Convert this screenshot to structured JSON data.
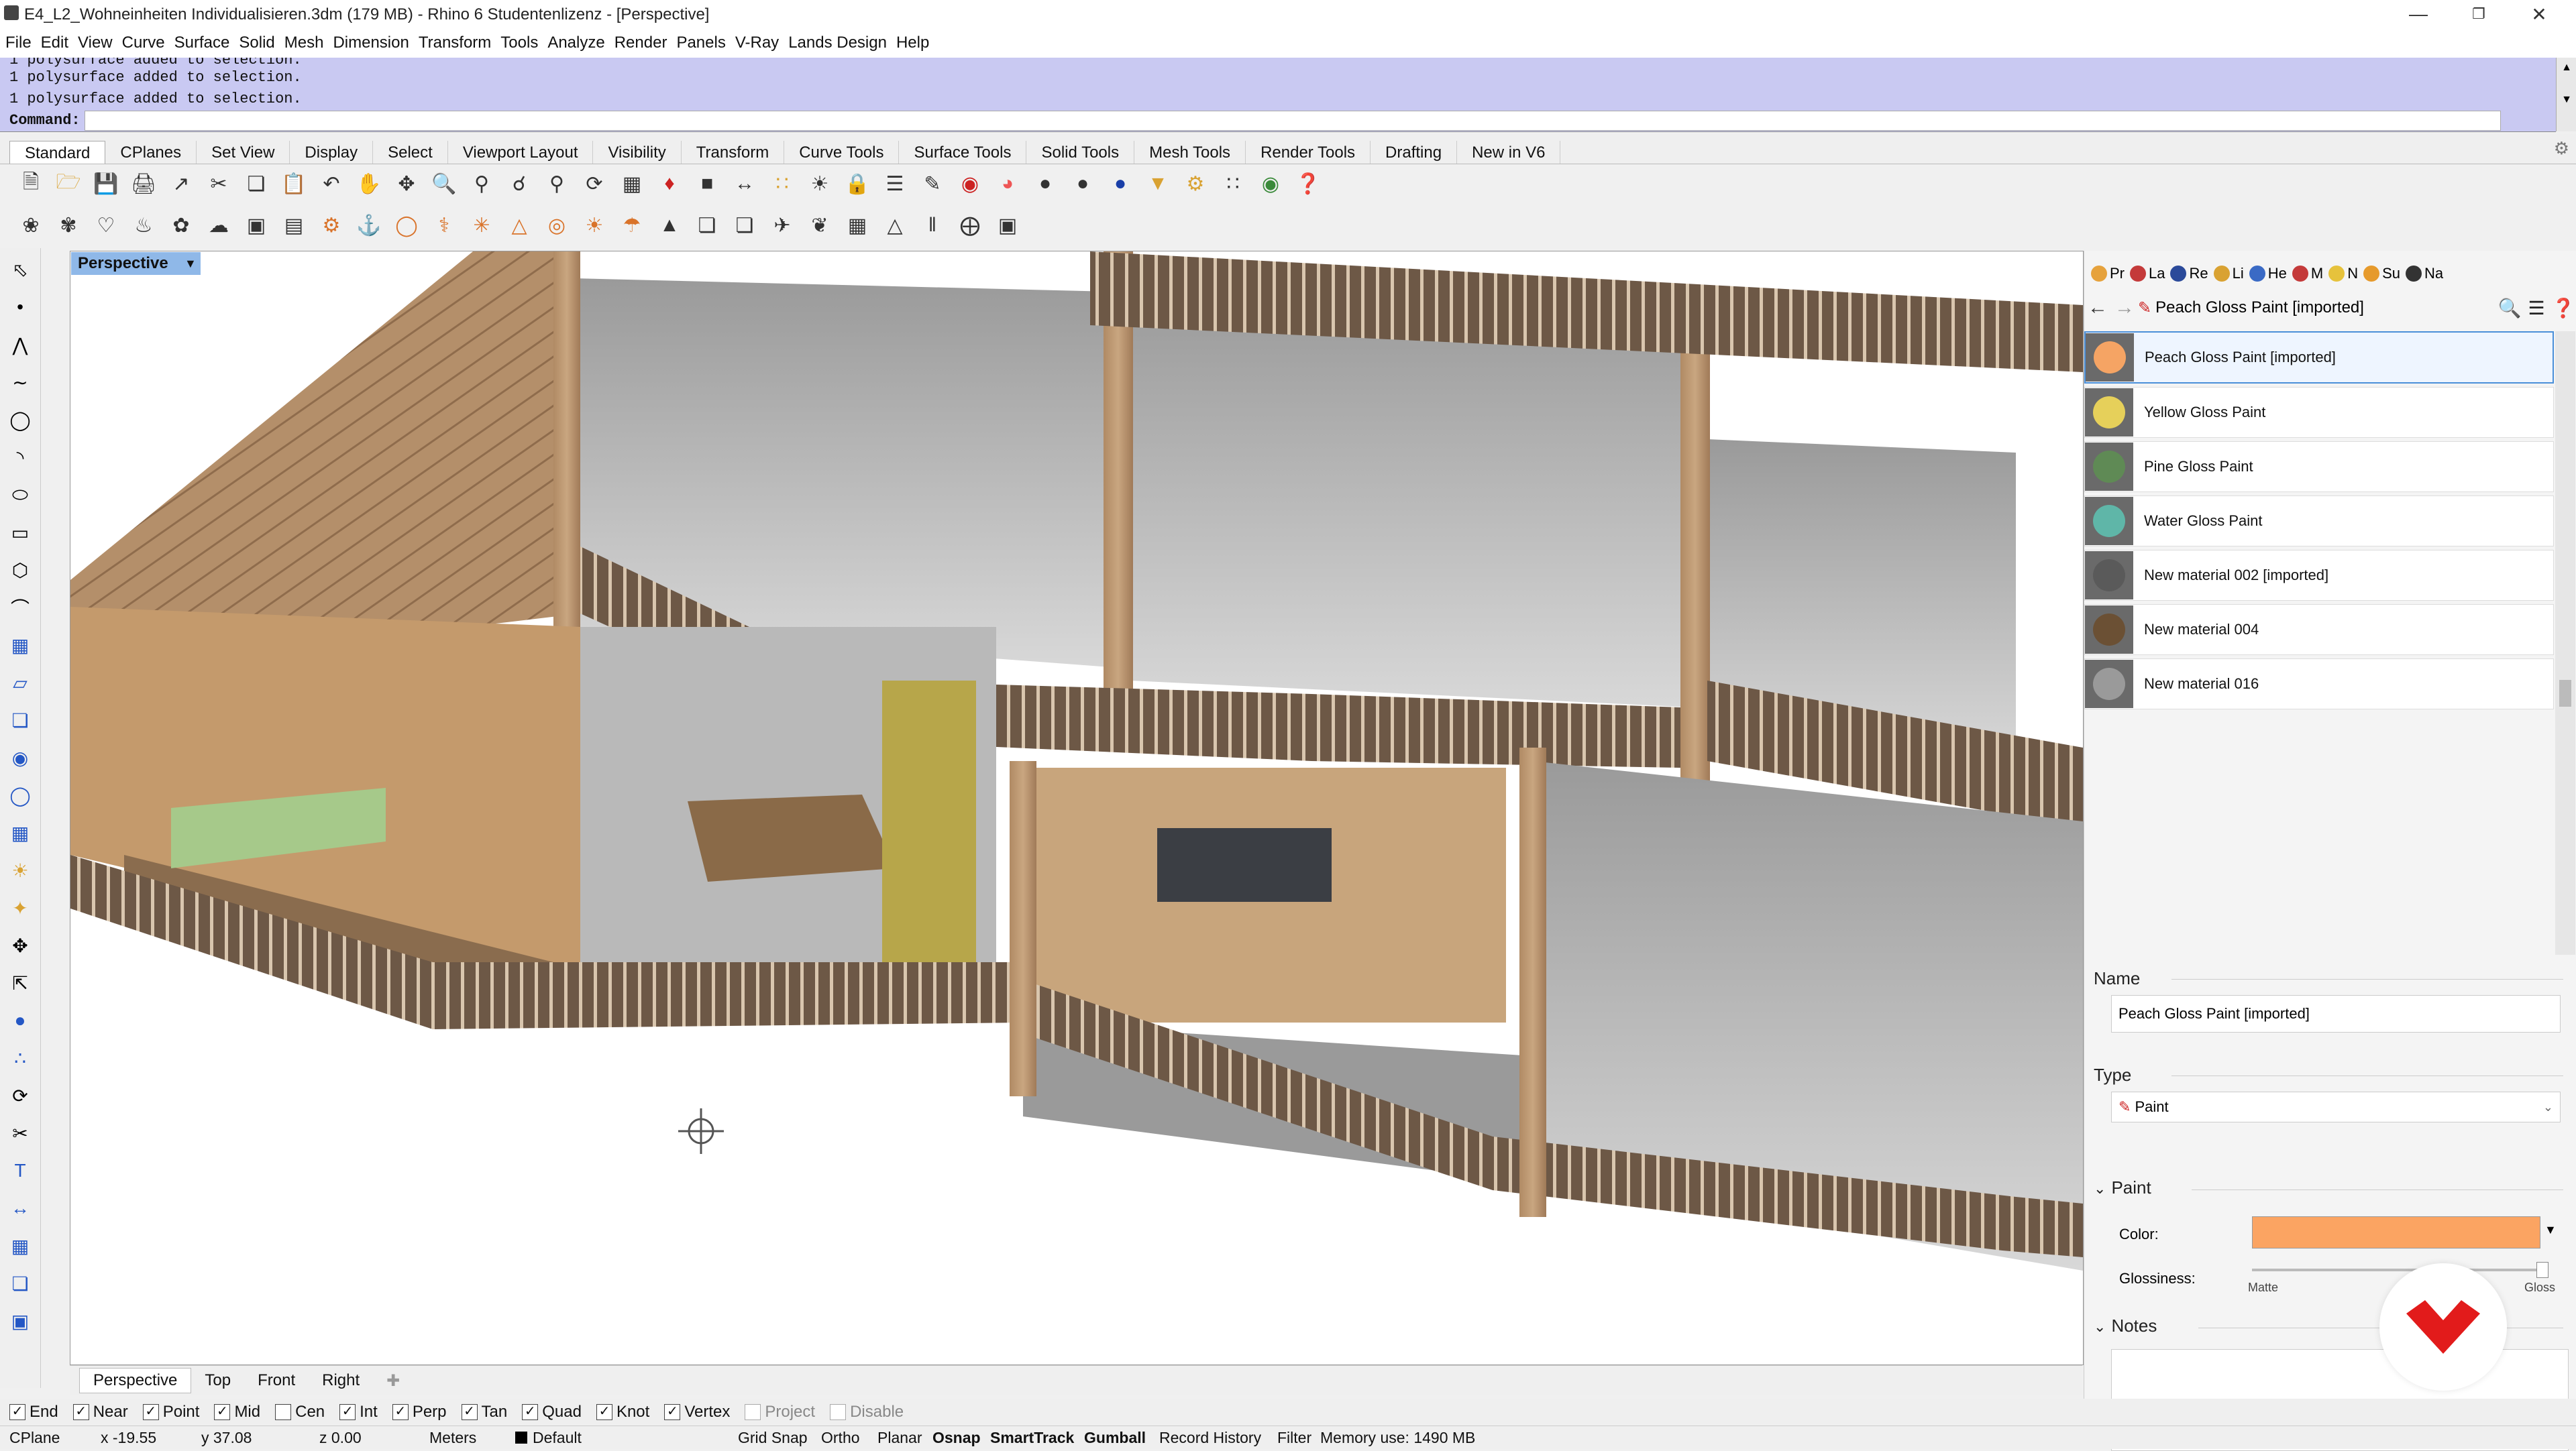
{
  "window": {
    "title": "E4_L2_Wohneinheiten Individualisieren.3dm (179 MB) - Rhino 6 Studentenlizenz - [Perspective]"
  },
  "menu": [
    "File",
    "Edit",
    "View",
    "Curve",
    "Surface",
    "Solid",
    "Mesh",
    "Dimension",
    "Transform",
    "Tools",
    "Analyze",
    "Render",
    "Panels",
    "V-Ray",
    "Lands Design",
    "Help"
  ],
  "command_history": {
    "line0": "1 polysurface added to selection.",
    "line1": "1 polysurface added to selection.",
    "line2": "1 polysurface added to selection.",
    "prompt": "Command:"
  },
  "toolbar_tabs": [
    "Standard",
    "CPlanes",
    "Set View",
    "Display",
    "Select",
    "Viewport Layout",
    "Visibility",
    "Transform",
    "Curve Tools",
    "Surface Tools",
    "Solid Tools",
    "Mesh Tools",
    "Render Tools",
    "Drafting",
    "New in V6"
  ],
  "viewport": {
    "label": "Perspective",
    "tabs": [
      "Perspective",
      "Top",
      "Front",
      "Right"
    ]
  },
  "panel": {
    "tabs": [
      "Pr",
      "La",
      "Re",
      "Li",
      "He",
      "M",
      "N",
      "Su",
      "Na"
    ],
    "breadcrumb": "Peach Gloss Paint [imported]",
    "materials": [
      {
        "name": "Peach Gloss Paint [imported]",
        "color": "#f5a464"
      },
      {
        "name": "Yellow Gloss Paint",
        "color": "#e6d05a"
      },
      {
        "name": "Pine Gloss Paint",
        "color": "#5f8a55"
      },
      {
        "name": "Water Gloss Paint",
        "color": "#5fb6a8"
      },
      {
        "name": "New material 002 [imported]",
        "color": "#5a5a5a"
      },
      {
        "name": "New material 004",
        "color": "#6b5034"
      },
      {
        "name": "New material 016",
        "color": "#9a9a9a"
      }
    ],
    "name_label": "Name",
    "name_value": "Peach Gloss Paint [imported]",
    "type_label": "Type",
    "type_value": "Paint",
    "paint_label": "Paint",
    "color_label": "Color:",
    "color_value": "#fba462",
    "glossiness_label": "Glossiness:",
    "matte_label": "Matte",
    "gloss_label": "Gloss",
    "notes_label": "Notes"
  },
  "osnaps": [
    {
      "label": "End",
      "checked": true
    },
    {
      "label": "Near",
      "checked": true
    },
    {
      "label": "Point",
      "checked": true
    },
    {
      "label": "Mid",
      "checked": true
    },
    {
      "label": "Cen",
      "checked": false
    },
    {
      "label": "Int",
      "checked": true
    },
    {
      "label": "Perp",
      "checked": true
    },
    {
      "label": "Tan",
      "checked": true
    },
    {
      "label": "Quad",
      "checked": true
    },
    {
      "label": "Knot",
      "checked": true
    },
    {
      "label": "Vertex",
      "checked": true
    },
    {
      "label": "Project",
      "checked": false
    },
    {
      "label": "Disable",
      "checked": false
    }
  ],
  "status": {
    "cplane": "CPlane",
    "x": "x -19.55",
    "y": "y 37.08",
    "z": "z 0.00",
    "units": "Meters",
    "layer": "Default",
    "grid_snap": "Grid Snap",
    "ortho": "Ortho",
    "planar": "Planar",
    "osnap": "Osnap",
    "smarttrack": "SmartTrack",
    "gumball": "Gumball",
    "record_history": "Record History",
    "filter": "Filter",
    "memory": "Memory use: 1490 MB"
  }
}
